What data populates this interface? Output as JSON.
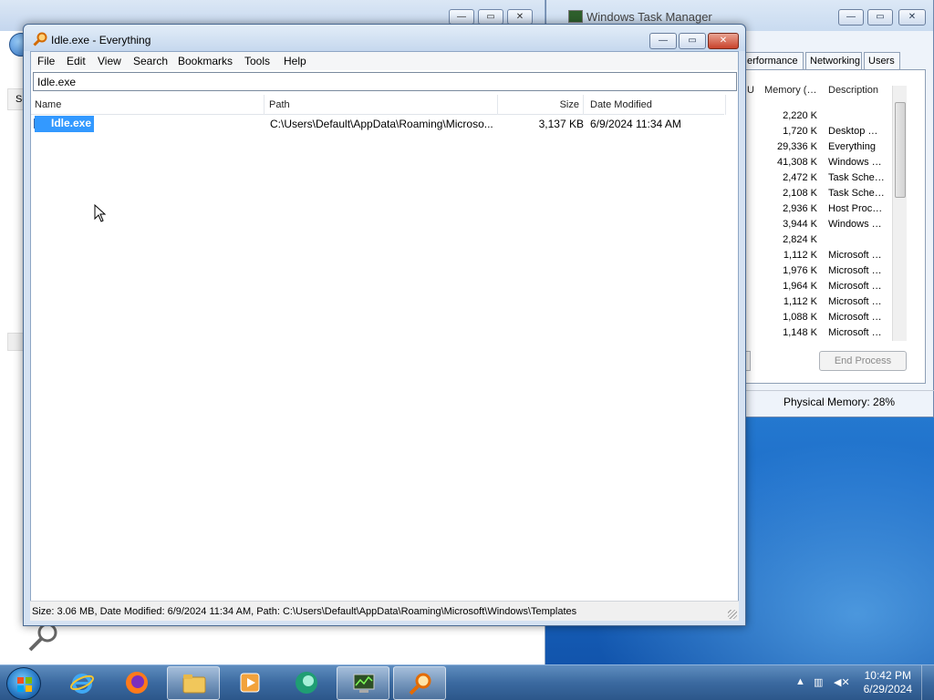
{
  "background_window": {
    "side_label": "Se"
  },
  "task_manager": {
    "title": "Windows Task Manager",
    "tabs": [
      "erformance",
      "Networking",
      "Users"
    ],
    "columns": {
      "cpu_fragment": "U",
      "memory": "Memory (…",
      "description": "Description"
    },
    "rows": [
      {
        "memory": "2,220 K",
        "description": ""
      },
      {
        "memory": "1,720 K",
        "description": "Desktop …"
      },
      {
        "memory": "29,336 K",
        "description": "Everything"
      },
      {
        "memory": "41,308 K",
        "description": "Windows …"
      },
      {
        "memory": "2,472 K",
        "description": "Task Sche…"
      },
      {
        "memory": "2,108 K",
        "description": "Task Sche…"
      },
      {
        "memory": "2,936 K",
        "description": "Host Proc…"
      },
      {
        "memory": "3,944 K",
        "description": "Windows …"
      },
      {
        "memory": "2,824 K",
        "description": ""
      },
      {
        "memory": "1,112 K",
        "description": "Microsoft …"
      },
      {
        "memory": "1,976 K",
        "description": "Microsoft …"
      },
      {
        "memory": "1,964 K",
        "description": "Microsoft …"
      },
      {
        "memory": "1,112 K",
        "description": "Microsoft …"
      },
      {
        "memory": "1,088 K",
        "description": "Microsoft …"
      },
      {
        "memory": "1,148 K",
        "description": "Microsoft …"
      }
    ],
    "end_process_label": "End Process",
    "status": "Physical Memory: 28%"
  },
  "everything": {
    "title": "Idle.exe - Everything",
    "menu": [
      "File",
      "Edit",
      "View",
      "Search",
      "Bookmarks",
      "Tools",
      "Help"
    ],
    "search_value": "Idle.exe",
    "columns": {
      "name": "Name",
      "path": "Path",
      "size": "Size",
      "date": "Date Modified"
    },
    "result": {
      "name": "Idle.exe",
      "path": "C:\\Users\\Default\\AppData\\Roaming\\Microso...",
      "size": "3,137 KB",
      "date": "6/9/2024 11:34 AM"
    },
    "status": "Size: 3.06 MB, Date Modified: 6/9/2024 11:34 AM, Path: C:\\Users\\Default\\AppData\\Roaming\\Microsoft\\Windows\\Templates"
  },
  "taskbar": {
    "pinned": [
      "internet-explorer",
      "firefox",
      "file-explorer",
      "media-player",
      "app-green",
      "task-manager",
      "everything"
    ],
    "clock_time": "10:42 PM",
    "clock_date": "6/29/2024"
  },
  "caption_glyphs": {
    "minimize": "—",
    "maximize": "▭",
    "close": "✕"
  },
  "colors": {
    "selection": "#3399ff",
    "taskbar": "#3b6aa0"
  }
}
